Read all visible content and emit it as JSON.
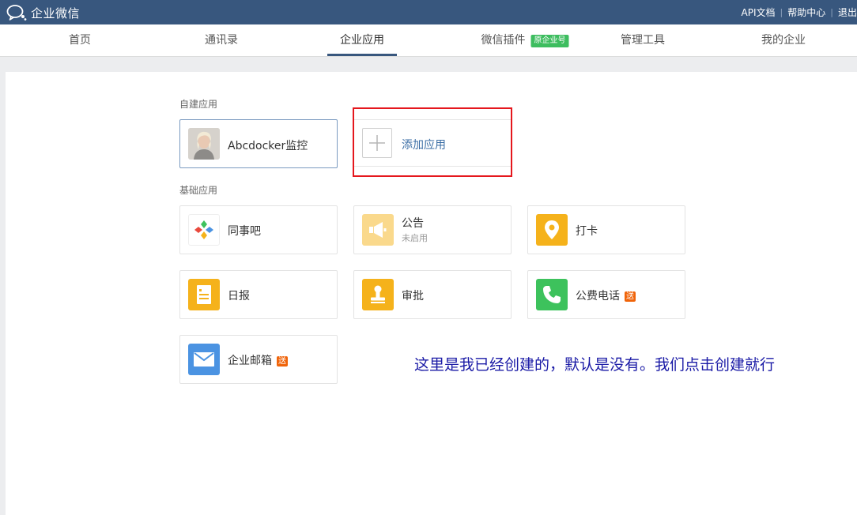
{
  "topbar": {
    "logo_text": "企业微信",
    "links": [
      "API文档",
      "帮助中心",
      "退出"
    ]
  },
  "nav": {
    "items": [
      "首页",
      "通讯录",
      "企业应用",
      "微信插件",
      "管理工具",
      "我的企业"
    ],
    "active": "企业应用",
    "plugin_badge": "原企业号"
  },
  "custom_apps": {
    "label": "自建应用",
    "apps": [
      {
        "name": "Abcdocker监控"
      }
    ],
    "add_label": "添加应用"
  },
  "basic_apps": {
    "label": "基础应用",
    "apps": [
      {
        "name": "同事吧",
        "icon": "tongshiba-icon"
      },
      {
        "name": "公告",
        "status": "未启用",
        "icon": "megaphone-icon"
      },
      {
        "name": "打卡",
        "icon": "location-pin-icon"
      },
      {
        "name": "日报",
        "icon": "report-icon"
      },
      {
        "name": "审批",
        "icon": "stamp-icon"
      },
      {
        "name": "公费电话",
        "badge": "送",
        "icon": "phone-icon"
      },
      {
        "name": "企业邮箱",
        "badge": "送",
        "icon": "mail-icon"
      }
    ]
  },
  "annotation": "这里是我已经创建的，默认是没有。我们点击创建就行",
  "colors": {
    "header": "#38577e",
    "accent_green": "#3dbd5f",
    "badge_orange": "#f0640a",
    "icon_yellow": "#f5b21b",
    "icon_green": "#3dc25c",
    "icon_blue": "#4b93e2",
    "annotation_box": "#e5171d",
    "annotation_text": "#1a1aa6"
  }
}
